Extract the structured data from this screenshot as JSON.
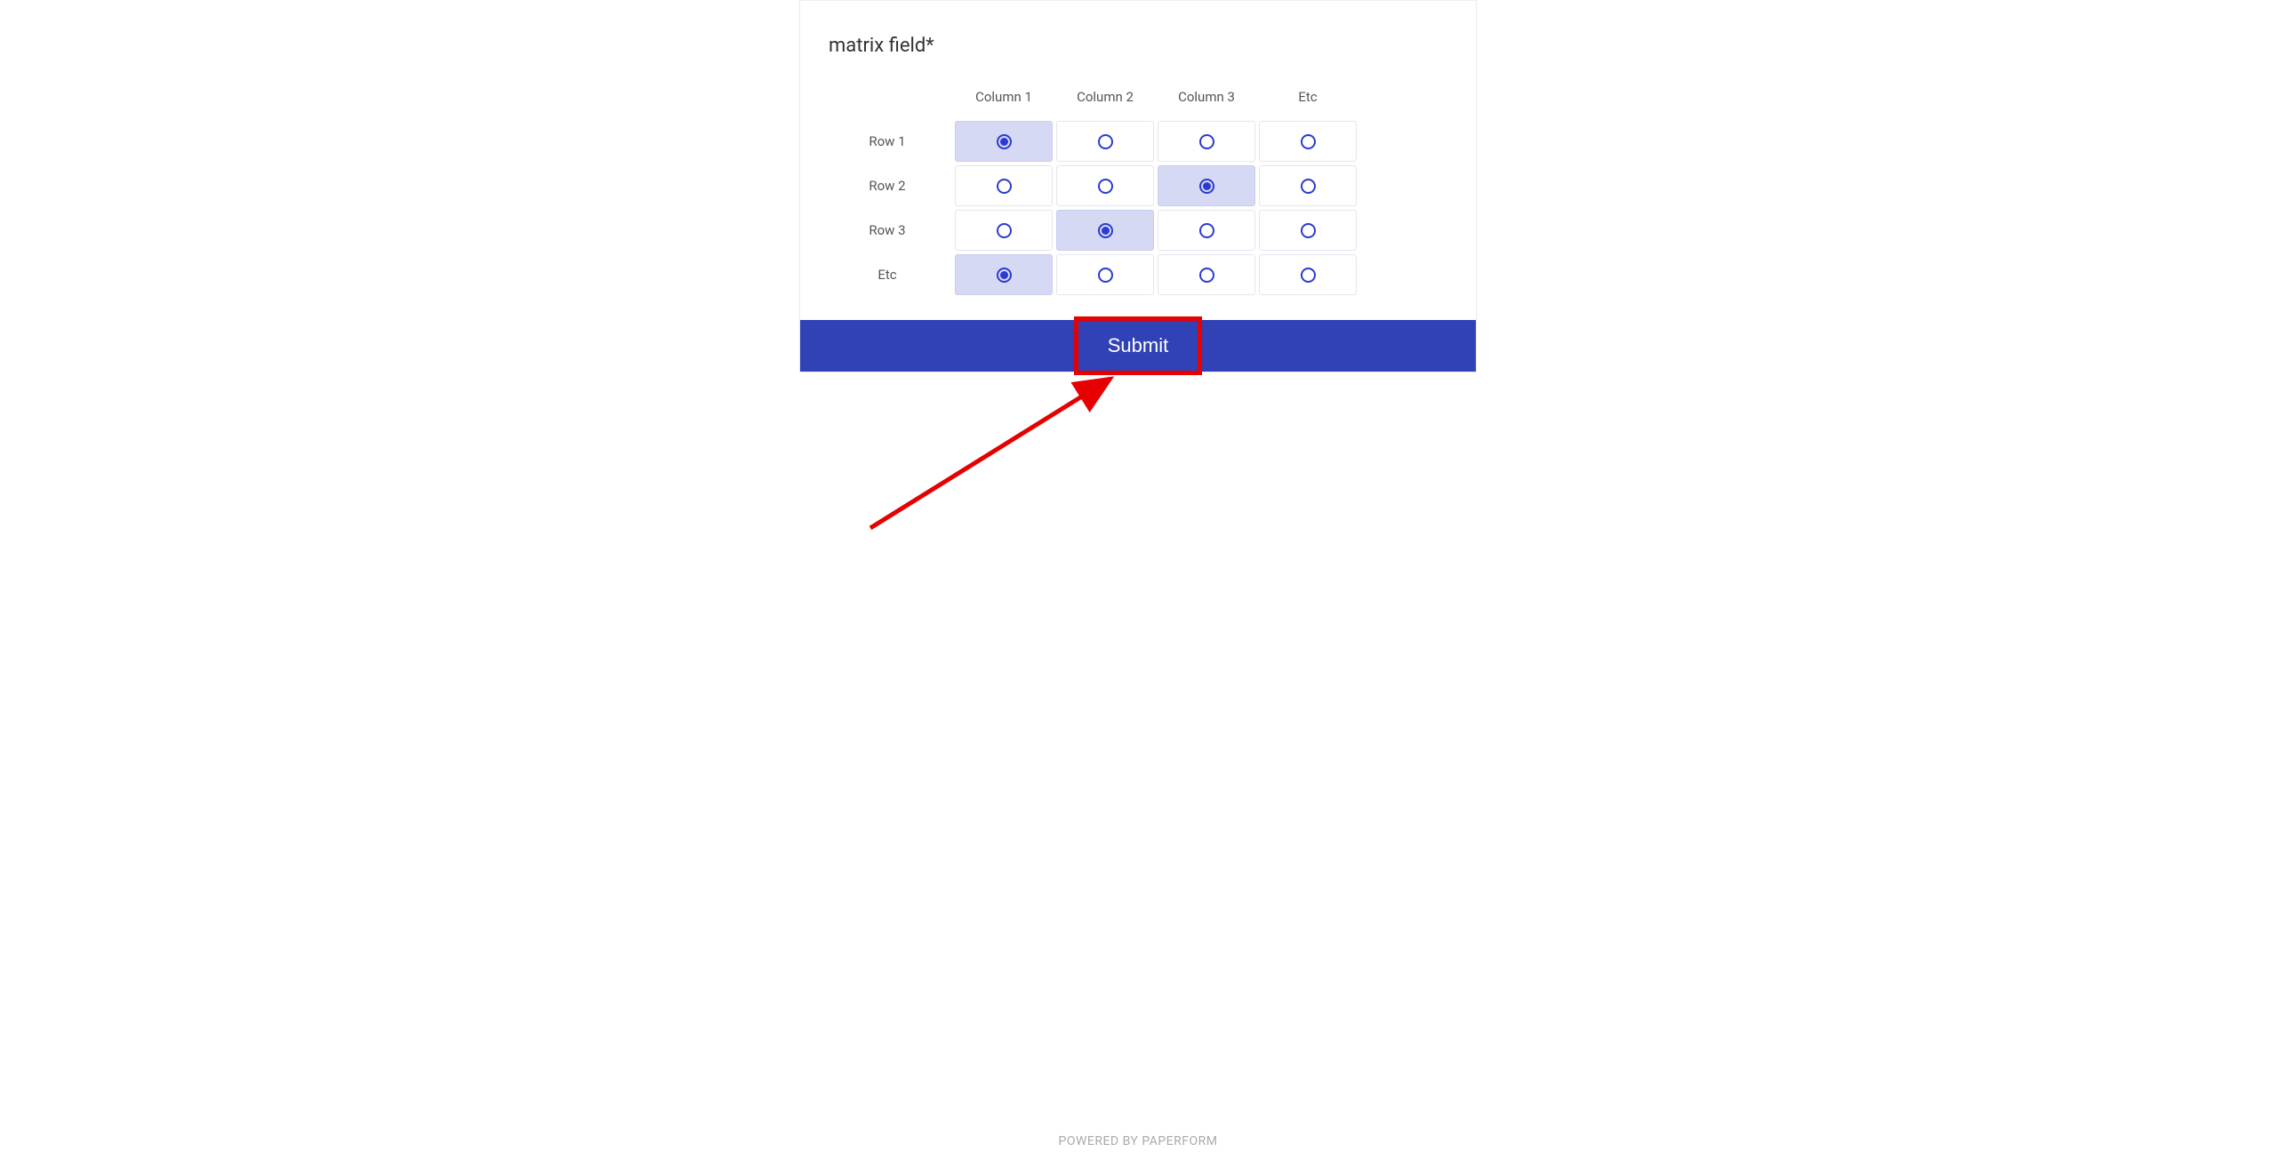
{
  "form": {
    "field_label": "matrix field*",
    "columns": [
      "Column 1",
      "Column 2",
      "Column 3",
      "Etc"
    ],
    "rows": [
      "Row 1",
      "Row 2",
      "Row 3",
      "Etc"
    ],
    "selections": [
      0,
      2,
      1,
      0
    ],
    "submit_label": "Submit"
  },
  "footer": {
    "text": "POWERED BY PAPERFORM"
  },
  "annotation": {
    "highlight_target": "submit-button",
    "highlight_color": "#e60000"
  }
}
